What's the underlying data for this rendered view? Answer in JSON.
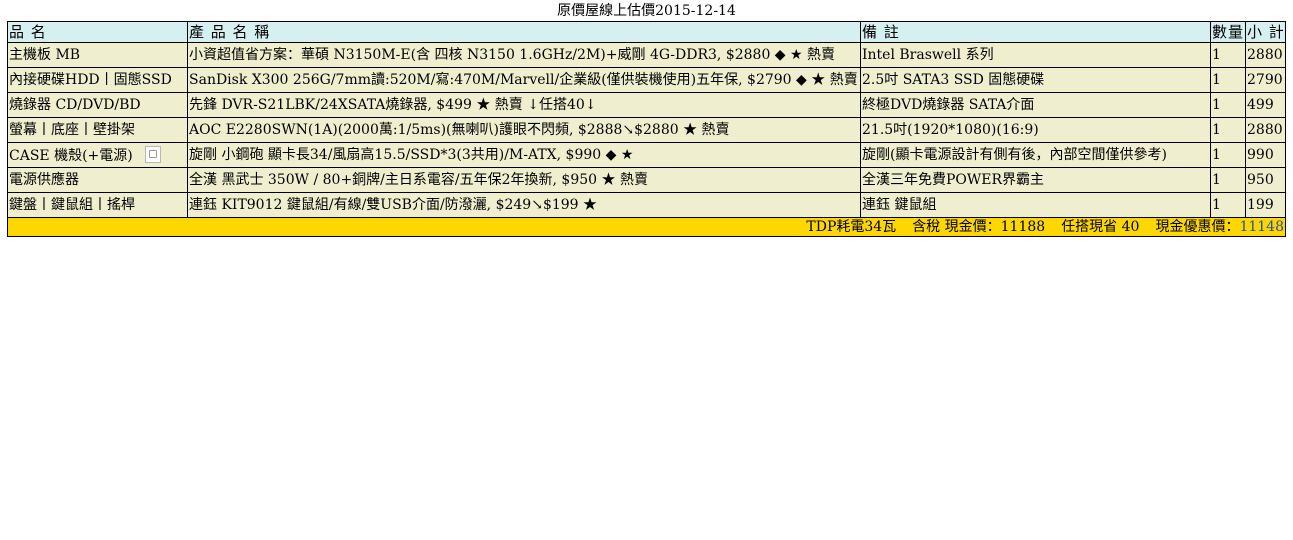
{
  "page": {
    "title": "原價屋線上估價2015-12-14"
  },
  "table": {
    "headers": [
      "品 名",
      "產 品 名 稱",
      "備 註",
      "數量",
      "小 計"
    ],
    "rows": [
      {
        "category": "主機板 MB",
        "product": "小資超值省方案：華碩 N3150M-E(含 四核 N3150 1.6GHz/2M)+威剛 4G-DDR3, $2880 ◆ ★ 熱賣",
        "note": "Intel Braswell 系列",
        "qty": "1",
        "subtotal": "2880"
      },
      {
        "category": "內接硬碟HDD丨固態SSD",
        "product": "SanDisk X300 256G/7mm讀:520M/寫:470M/Marvell/企業級(僅供裝機使用)五年保, $2790 ◆ ★ 熱賣",
        "note": "2.5吋 SATA3 SSD 固態硬碟",
        "qty": "1",
        "subtotal": "2790"
      },
      {
        "category": "燒錄器 CD/DVD/BD",
        "product": "先鋒 DVR-S21LBK/24XSATA燒錄器, $499 ★ 熱賣 ↓任搭40↓",
        "note": "終極DVD燒錄器 SATA介面",
        "qty": "1",
        "subtotal": "499"
      },
      {
        "category": "螢幕丨底座丨壁掛架",
        "product": "AOC E2280SWN(1A)(2000萬:1/5ms)(無喇叭)護眼不閃頻, $2888↘$2880 ★ 熱賣",
        "note": "21.5吋(1920*1080)(16:9)",
        "qty": "1",
        "subtotal": "2880"
      },
      {
        "category": "CASE 機殼(+電源)",
        "product": "旋剛 小鋼砲 顯卡長34/風扇高15.5/SSD*3(3共用)/M-ATX, $990 ◆ ★",
        "note": "旋剛(顯卡電源設計有側有後，內部空間僅供參考)",
        "qty": "1",
        "subtotal": "990",
        "has_image": true
      },
      {
        "category": "電源供應器",
        "product": "全漢 黑武士 350W / 80+銅牌/主日系電容/五年保2年換新, $950 ★ 熱賣",
        "note": "全漢三年免費POWER界霸主",
        "qty": "1",
        "subtotal": "950"
      },
      {
        "category": "鍵盤丨鍵鼠組丨搖桿",
        "product": "連鈺 KIT9012 鍵鼠組/有線/雙USB介面/防潑灑, $249↘$199 ★",
        "note": "連鈺 鍵鼠組",
        "qty": "1",
        "subtotal": "199"
      }
    ]
  },
  "summary": {
    "tdp": "TDP耗電34瓦",
    "tax_cash_label": "含稅 現金價：11188",
    "bundle_saving": "任搭現省 40",
    "cash_discount_label": "現金優惠價：",
    "cash_discount_value": "11148"
  },
  "colors": {
    "header_bg": "#d6f0f2",
    "row_bg": "#efefcf",
    "total_bg": "#ffd700",
    "accent": "#2a4fa8"
  }
}
